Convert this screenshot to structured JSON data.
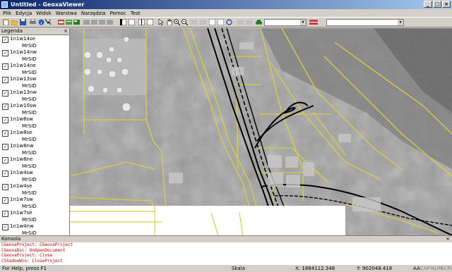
{
  "window": {
    "title": "Untitled - GeoxaViewer"
  },
  "menu": [
    "Plik",
    "Edycja",
    "Widok",
    "Warstwa",
    "Narzędzia",
    "Pomoc",
    "Test"
  ],
  "legend": {
    "title": "Legenda",
    "layers": [
      {
        "name": "1n1w14se",
        "type": "MrSID"
      },
      {
        "name": "1n1w14nw",
        "type": "MrSID"
      },
      {
        "name": "1n1w14ne",
        "type": "MrSID"
      },
      {
        "name": "1n1w13sw",
        "type": "MrSID"
      },
      {
        "name": "1n1w13nw",
        "type": "MrSID"
      },
      {
        "name": "1n1w10sw",
        "type": "MrSID"
      },
      {
        "name": "1n1w8sw",
        "type": "MrSID"
      },
      {
        "name": "1n1w8se",
        "type": "MrSID"
      },
      {
        "name": "1n1w8nw",
        "type": "MrSID"
      },
      {
        "name": "1n1w8ne",
        "type": "MrSID"
      },
      {
        "name": "1n1w4sw",
        "type": "MrSID"
      },
      {
        "name": "1n1w4se",
        "type": "MrSID"
      },
      {
        "name": "1n1w7sw",
        "type": "MrSID"
      },
      {
        "name": "1n1w7se",
        "type": "MrSID"
      },
      {
        "name": "1n1w4nw",
        "type": "MrSID"
      }
    ]
  },
  "console": {
    "title": "Konsola",
    "lines": [
      "CGeoxaProject: CGeoxaProject",
      "CGeoxaDoc: OnOpenDocument",
      "CGeoxaProject: Close",
      "CShadowWin: CloseProject"
    ]
  },
  "status": {
    "help": "For Help, press F1",
    "scale_label": "Skala",
    "x": "X: 1884112.348",
    "y": "Y: 902048.418",
    "aa": "AA",
    "indicators": [
      "CAP",
      "NUM",
      "SCRL"
    ]
  },
  "colors": {
    "road": "#d8d040",
    "railway": "#000000",
    "console_text": "#c00000"
  },
  "icons": [
    "new-icon",
    "open-icon",
    "save-icon",
    "print-icon",
    "info-icon",
    "help-icon",
    "layer-icon",
    "table-icon",
    "select-arrow-icon",
    "pan-hand-icon",
    "zoom-in-icon",
    "zoom-out-icon",
    "zoom-extent-icon",
    "refresh-icon",
    "binoculars-icon"
  ]
}
